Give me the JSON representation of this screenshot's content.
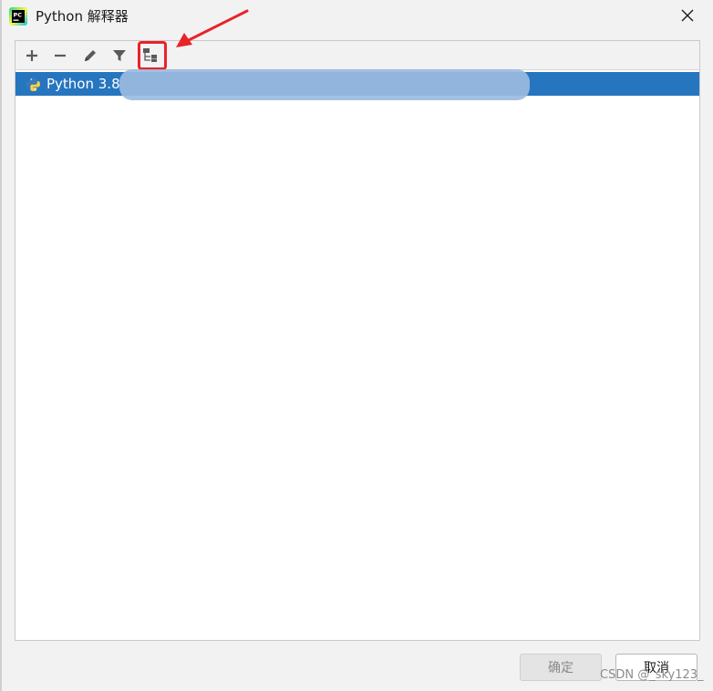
{
  "window": {
    "title": "Python 解释器"
  },
  "toolbar": {
    "add_icon": "plus-icon",
    "remove_icon": "minus-icon",
    "edit_icon": "pencil-icon",
    "filter_icon": "filter-icon",
    "paths_icon": "interpreter-paths-icon"
  },
  "interpreters": [
    {
      "label": "Python 3.8",
      "selected": true
    }
  ],
  "footer": {
    "ok_label": "确定",
    "cancel_label": "取消",
    "ok_enabled": false
  },
  "watermark": "CSDN @_sky123_",
  "colors": {
    "selection": "#2675bf",
    "annotation_red": "#e8232a"
  }
}
